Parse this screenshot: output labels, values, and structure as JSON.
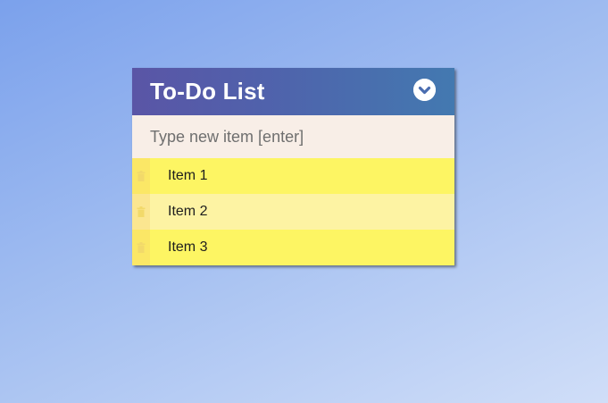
{
  "app": {
    "title": "To-Do List",
    "toggle_icon": "chevron-down-circle-icon"
  },
  "input": {
    "placeholder": "Type new item [enter]",
    "value": ""
  },
  "items": [
    {
      "label": "Item 1",
      "delete_icon": "trash-icon"
    },
    {
      "label": "Item 2",
      "delete_icon": "trash-icon"
    },
    {
      "label": "Item 3",
      "delete_icon": "trash-icon"
    }
  ],
  "colors": {
    "header_start": "#5a55a6",
    "header_end": "#4379b0",
    "input_bg": "#f8eee7",
    "item_odd": "#fdf563",
    "item_even": "#fdf3a3"
  }
}
